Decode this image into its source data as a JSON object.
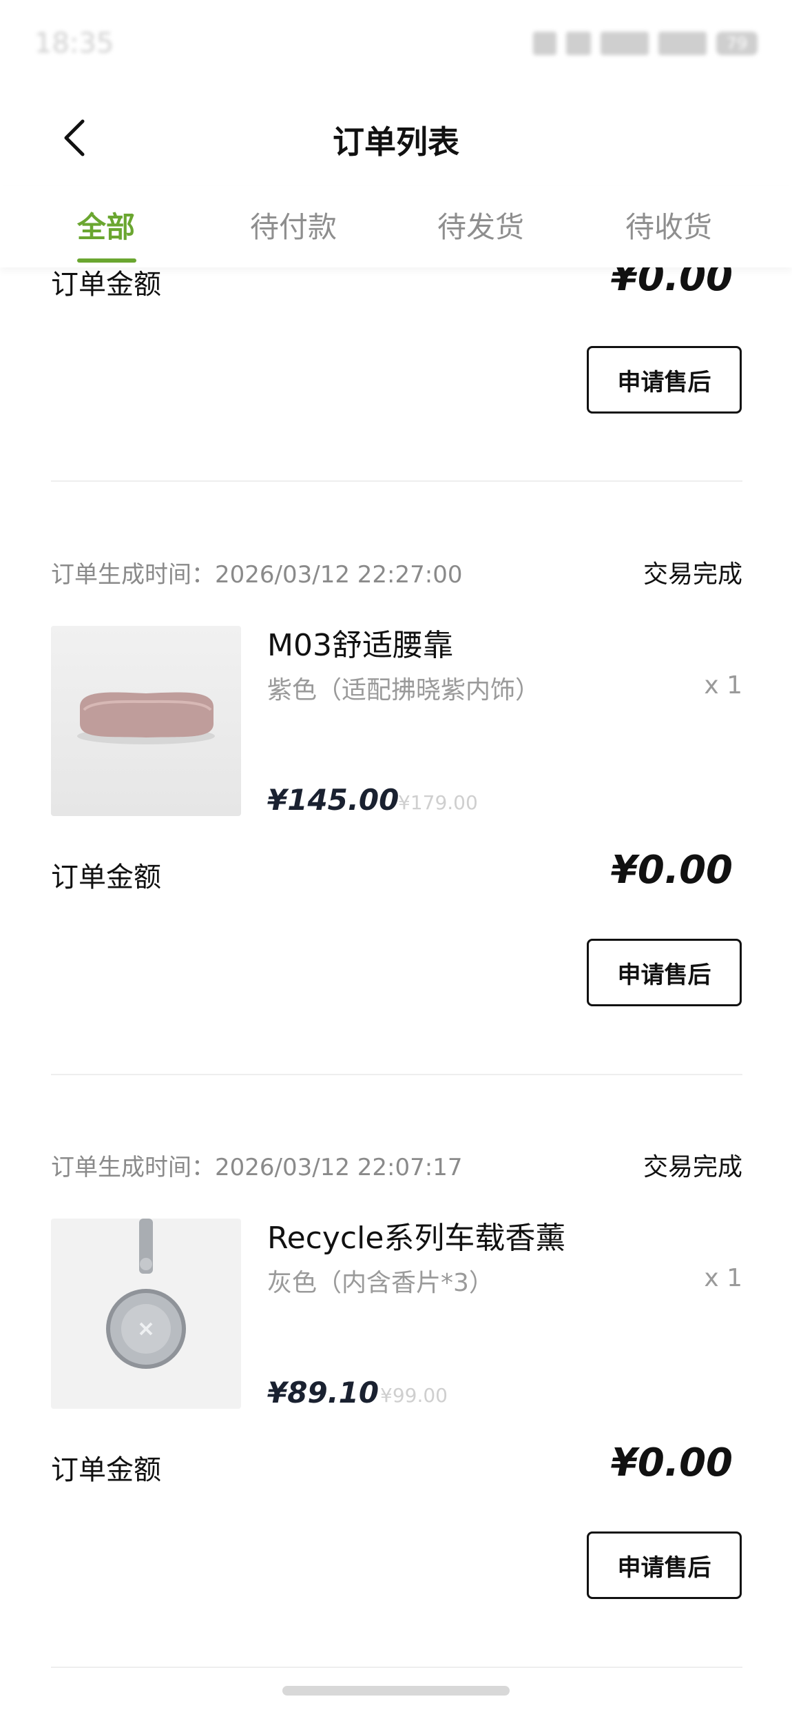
{
  "status_bar": {
    "time": "18:35",
    "battery": "79"
  },
  "header": {
    "title": "订单列表"
  },
  "tabs": [
    {
      "label": "全部",
      "active": true
    },
    {
      "label": "待付款",
      "active": false
    },
    {
      "label": "待发货",
      "active": false
    },
    {
      "label": "待收货",
      "active": false
    }
  ],
  "partial_order": {
    "total_label": "订单金额",
    "total_value": "¥0.00",
    "after_sale_label": "申请售后"
  },
  "orders": [
    {
      "time_label": "订单生成时间：2026/03/12 22:27:00",
      "status": "交易完成",
      "product_name": "M03舒适腰靠",
      "product_spec": "紫色（适配拂晓紫内饰）",
      "quantity": "x 1",
      "price": "¥145.00",
      "original_price": "¥179.00",
      "total_label": "订单金额",
      "total_value": "¥0.00",
      "after_sale_label": "申请售后",
      "thumb_icon": "lumbar-pillow-image"
    },
    {
      "time_label": "订单生成时间：2026/03/12 22:07:17",
      "status": "交易完成",
      "product_name": "Recycle系列车载香薰",
      "product_spec": "灰色（内含香片*3）",
      "quantity": "x 1",
      "price": "¥89.10",
      "original_price": "¥99.00",
      "total_label": "订单金额",
      "total_value": "¥0.00",
      "after_sale_label": "申请售后",
      "thumb_icon": "car-aroma-diffuser-image"
    }
  ],
  "colors": {
    "accent": "#6aa630",
    "text": "#111111",
    "muted": "#8a8a8a"
  }
}
